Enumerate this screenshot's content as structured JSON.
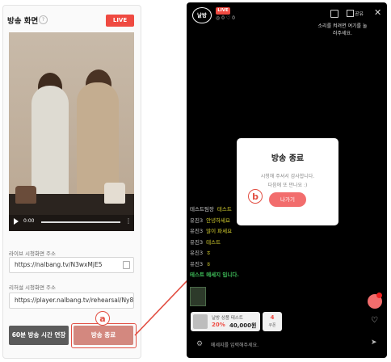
{
  "left": {
    "title": "방송 화면",
    "help_icon_label": "?",
    "live_badge": "LIVE",
    "video": {
      "time": "0:00",
      "menu": "⋮"
    },
    "live_url": {
      "label": "라이브 시청화면 주소",
      "value": "https://nalbang.tv/N3wxMjE5"
    },
    "rehearsal_url": {
      "label": "리허설 시청화면 주소",
      "value": "https://player.nalbang.tv/rehearsal/Ny8xIfj"
    },
    "extend_button": "60분 방송 시간 연장",
    "end_button": "방송 종료",
    "marker": "a"
  },
  "phone": {
    "logo": "날방",
    "live_badge": "LIVE",
    "counts": "◎ 0 ♡ 0",
    "share_label": "공유",
    "close": "✕",
    "sound_notice": "소리를 켜려면 여기를 눌러주세요.",
    "modal": {
      "title": "방송 종료",
      "line1": "시청해 주셔서 감사합니다.",
      "line2": "다음에 또 만나요 :)",
      "exit_button": "나가기"
    },
    "marker": "b",
    "chat": [
      {
        "user": "테스트팀장",
        "msg": "테스트"
      },
      {
        "user": "유진3",
        "msg": "안녕하세요"
      },
      {
        "user": "유진3",
        "msg": "많이 파세요"
      },
      {
        "user": "유진3",
        "msg": "테스트"
      },
      {
        "user": "유진3",
        "msg": "ㅎ"
      },
      {
        "user": "유진3",
        "msg": "ㅎ"
      }
    ],
    "system_message": "테스트 메세지 입니다.",
    "product": {
      "name": "날방 상품 테스트",
      "discount": "20%",
      "price": "40,000원"
    },
    "coupon": {
      "count": "4",
      "label": "쿠폰"
    },
    "heart": "♡",
    "settings_icon": "⚙",
    "chat_placeholder": "메세지를 입력해주세요.",
    "send_icon": "➤"
  },
  "colors": {
    "accent": "#ef4a41",
    "marker": "#e24f43",
    "end_button": "#d3887f",
    "exit_button": "#f26d6d",
    "chat_msg": "#d5cf2f",
    "system_msg": "#3fbf5a"
  }
}
